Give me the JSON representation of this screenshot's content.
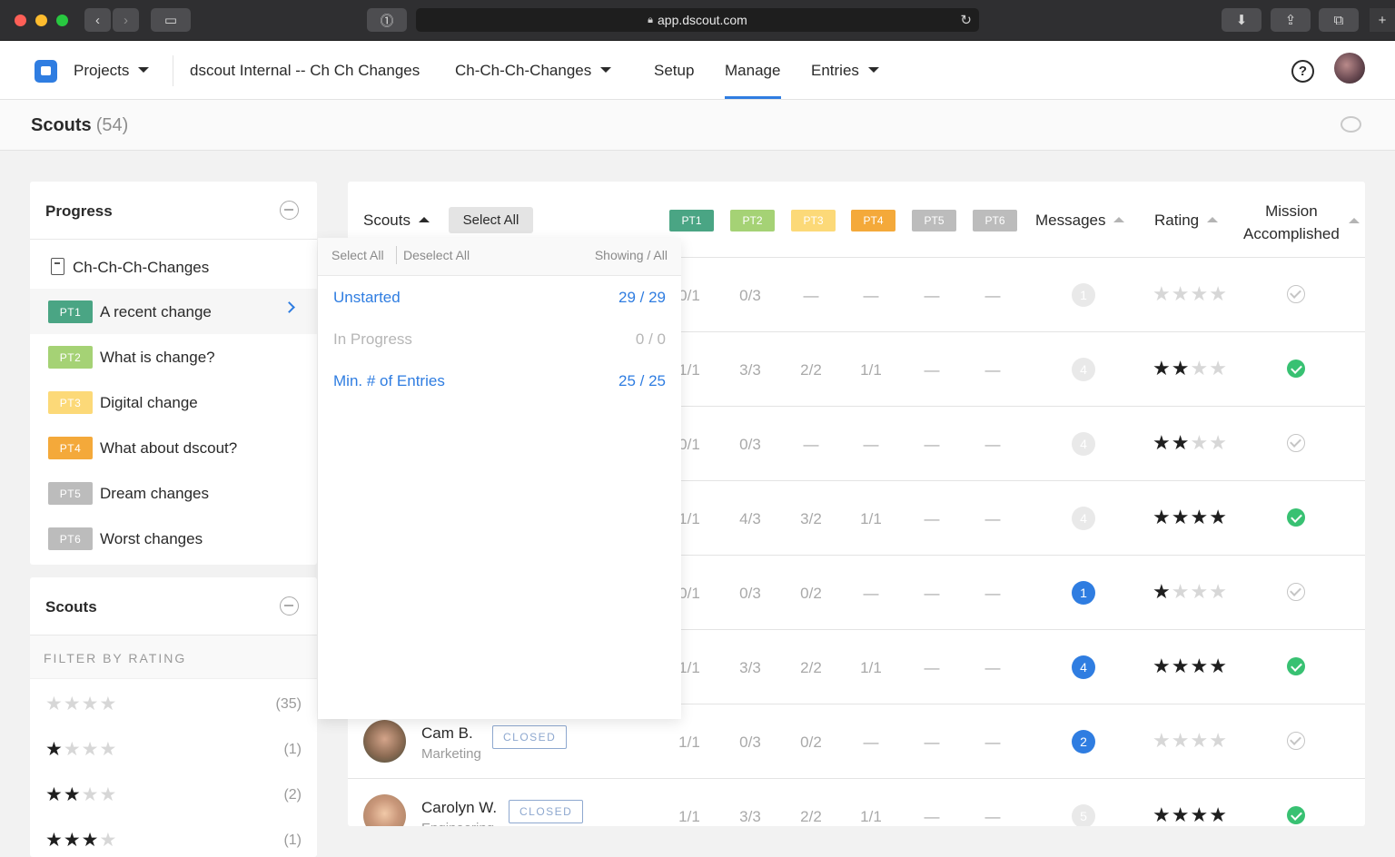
{
  "browser": {
    "url": "app.dscout.com"
  },
  "nav": {
    "projects": "Projects",
    "project_name": "dscout Internal -- Ch Ch Changes",
    "mission": "Ch-Ch-Ch-Changes",
    "setup": "Setup",
    "manage": "Manage",
    "entries": "Entries",
    "help": "?"
  },
  "page": {
    "title": "Scouts",
    "count": "(54)"
  },
  "progress": {
    "title": "Progress",
    "mission": "Ch-Ch-Ch-Changes",
    "parts": [
      {
        "tag": "PT1",
        "label": "A recent change",
        "color": "#4aa584"
      },
      {
        "tag": "PT2",
        "label": "What is change?",
        "color": "#a5d275"
      },
      {
        "tag": "PT3",
        "label": "Digital change",
        "color": "#fcd978"
      },
      {
        "tag": "PT4",
        "label": "What about dscout?",
        "color": "#f4a93a"
      },
      {
        "tag": "PT5",
        "label": "Dream changes",
        "color": "#bcbcbc"
      },
      {
        "tag": "PT6",
        "label": "Worst changes",
        "color": "#bcbcbc"
      }
    ]
  },
  "scouts_filter": {
    "title": "Scouts",
    "filter_label": "FILTER BY RATING",
    "ratings": [
      {
        "stars": 0,
        "count": "(35)"
      },
      {
        "stars": 1,
        "count": "(1)"
      },
      {
        "stars": 2,
        "count": "(2)"
      },
      {
        "stars": 3,
        "count": "(1)"
      }
    ]
  },
  "table": {
    "headers": {
      "scouts": "Scouts",
      "select_all": "Select All",
      "messages": "Messages",
      "rating": "Rating",
      "mission_line1": "Mission",
      "mission_line2": "Accomplished"
    },
    "part_headers": [
      "PT1",
      "PT2",
      "PT3",
      "PT4",
      "PT5",
      "PT6"
    ],
    "rows": [
      {
        "parts": [
          "0/1",
          "0/3",
          "—",
          "—",
          "—",
          "—"
        ],
        "messages": "1",
        "msg_active": false,
        "rating": 0,
        "accomplished": false
      },
      {
        "parts": [
          "1/1",
          "3/3",
          "2/2",
          "1/1",
          "—",
          "—"
        ],
        "messages": "4",
        "msg_active": false,
        "rating": 2,
        "accomplished": true
      },
      {
        "parts": [
          "0/1",
          "0/3",
          "—",
          "—",
          "—",
          "—"
        ],
        "messages": "4",
        "msg_active": false,
        "rating": 2,
        "accomplished": false
      },
      {
        "parts": [
          "1/1",
          "4/3",
          "3/2",
          "1/1",
          "—",
          "—"
        ],
        "messages": "4",
        "msg_active": false,
        "rating": 4,
        "accomplished": true
      },
      {
        "parts": [
          "0/1",
          "0/3",
          "0/2",
          "—",
          "—",
          "—"
        ],
        "messages": "1",
        "msg_active": true,
        "rating": 1,
        "accomplished": false
      },
      {
        "parts": [
          "1/1",
          "3/3",
          "2/2",
          "1/1",
          "—",
          "—"
        ],
        "messages": "4",
        "msg_active": true,
        "rating": 4,
        "accomplished": true
      },
      {
        "name": "Cam B.",
        "role": "Marketing",
        "status": "CLOSED",
        "parts": [
          "1/1",
          "0/3",
          "0/2",
          "—",
          "—",
          "—"
        ],
        "messages": "2",
        "msg_active": true,
        "rating": 0,
        "accomplished": false
      },
      {
        "name": "Carolyn W.",
        "role": "Engineering",
        "status": "CLOSED",
        "parts": [
          "1/1",
          "3/3",
          "2/2",
          "1/1",
          "—",
          "—"
        ],
        "messages": "5",
        "msg_active": false,
        "rating": 4,
        "accomplished": true
      }
    ]
  },
  "dropdown": {
    "select_all": "Select All",
    "deselect_all": "Deselect All",
    "showing": "Showing / All",
    "items": [
      {
        "label": "Unstarted",
        "count": "29 / 29",
        "enabled": true
      },
      {
        "label": "In Progress",
        "count": "0 / 0",
        "enabled": false
      },
      {
        "label": "Min. # of Entries",
        "count": "25 / 25",
        "enabled": true
      }
    ]
  }
}
